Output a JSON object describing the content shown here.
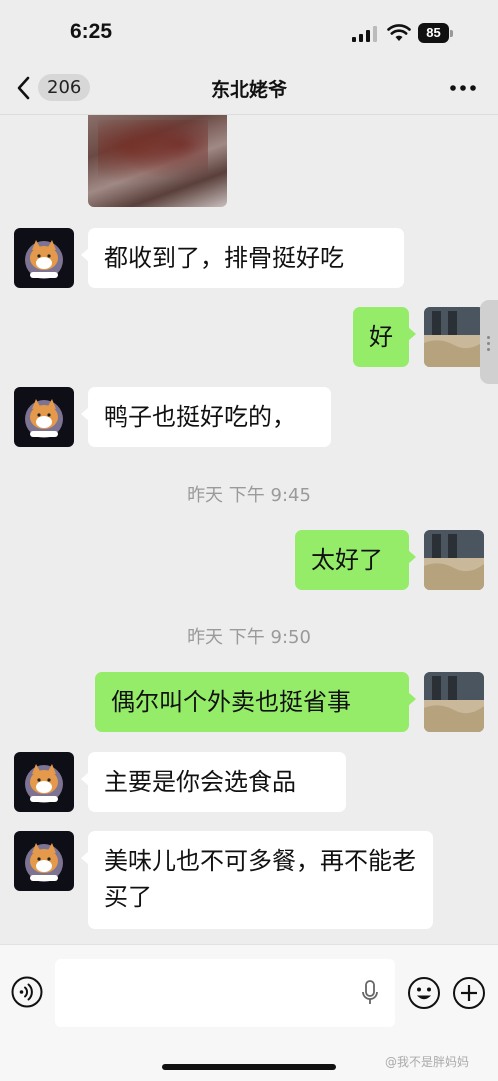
{
  "status_bar": {
    "time": "6:25",
    "battery": "85"
  },
  "nav": {
    "unread_count": "206",
    "title": "东北姥爷"
  },
  "messages": [
    {
      "side": "left",
      "text": "都收到了，排骨挺好吃"
    },
    {
      "side": "right",
      "text": "好"
    },
    {
      "side": "left",
      "text": "鸭子也挺好吃的，"
    },
    {
      "type": "timestamp",
      "text": "昨天 下午 9:45"
    },
    {
      "side": "right",
      "text": "太好了"
    },
    {
      "type": "timestamp",
      "text": "昨天 下午 9:50"
    },
    {
      "side": "right",
      "text": "偶尔叫个外卖也挺省事"
    },
    {
      "side": "left",
      "text": "主要是你会选食品"
    },
    {
      "side": "left",
      "text": "美味儿也不可多餐，再不能老买了"
    }
  ],
  "input": {
    "placeholder": ""
  },
  "watermark": "@我不是胖妈妈",
  "colors": {
    "sent_bubble": "#95ec69",
    "received_bubble": "#ffffff",
    "background": "#ededed"
  },
  "icons": [
    "back-chevron-icon",
    "more-dots-icon",
    "voice-icon",
    "mic-icon",
    "emoji-icon",
    "plus-icon"
  ]
}
